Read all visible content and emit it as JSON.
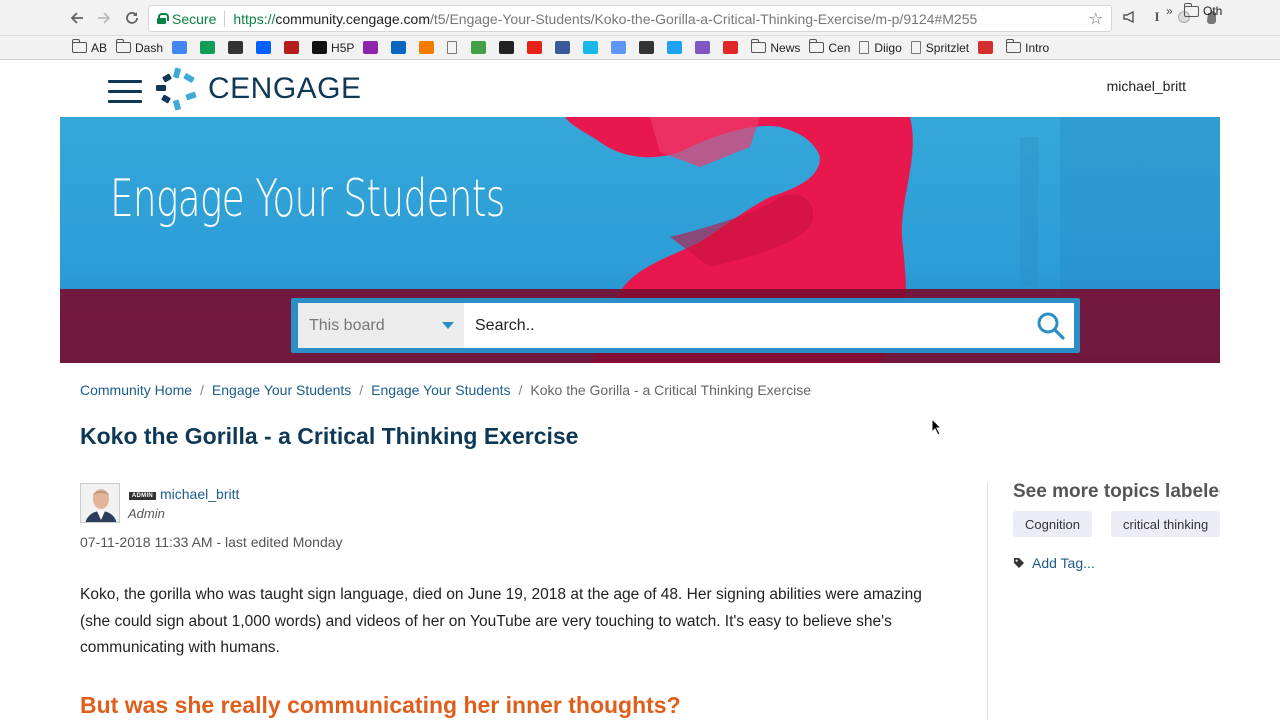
{
  "browser": {
    "secure_label": "Secure",
    "url_protocol": "https://",
    "url_host": "community.cengage.com",
    "url_path": "/t5/Engage-Your-Students/Koko-the-Gorilla-a-Critical-Thinking-Exercise/m-p/9124#M255",
    "bookmarks": [
      {
        "label": "AB",
        "icon": "folder-icon"
      },
      {
        "label": "Dash",
        "icon": "folder-icon"
      },
      {
        "label": "",
        "icon": "google-icon",
        "color": "#4285f4"
      },
      {
        "label": "",
        "icon": "drive-icon",
        "color": "#0f9d58"
      },
      {
        "label": "",
        "icon": "app-icon",
        "color": "#333333"
      },
      {
        "label": "",
        "icon": "dropbox-icon",
        "color": "#0061ff"
      },
      {
        "label": "",
        "icon": "app-icon",
        "color": "#b71c1c"
      },
      {
        "label": "H5P",
        "icon": "h5p-icon",
        "color": "#111111"
      },
      {
        "label": "",
        "icon": "app-icon",
        "color": "#8e24aa"
      },
      {
        "label": "",
        "icon": "linkedin-icon",
        "color": "#0a66c2"
      },
      {
        "label": "",
        "icon": "app-icon",
        "color": "#f57c00"
      },
      {
        "label": "",
        "icon": "doc-icon",
        "color": "#777777"
      },
      {
        "label": "",
        "icon": "app-icon",
        "color": "#43a047"
      },
      {
        "label": "",
        "icon": "buffer-icon",
        "color": "#222222"
      },
      {
        "label": "",
        "icon": "youtube-icon",
        "color": "#e62117"
      },
      {
        "label": "",
        "icon": "facebook-icon",
        "color": "#3b5998"
      },
      {
        "label": "",
        "icon": "vimeo-icon",
        "color": "#1ab7ea"
      },
      {
        "label": "",
        "icon": "app-icon",
        "color": "#5e97f6"
      },
      {
        "label": "",
        "icon": "app-icon",
        "color": "#333333"
      },
      {
        "label": "",
        "icon": "twitter-icon",
        "color": "#1da1f2"
      },
      {
        "label": "",
        "icon": "app-icon",
        "color": "#7e57c2"
      },
      {
        "label": "",
        "icon": "flipboard-icon",
        "color": "#e12828"
      },
      {
        "label": "News",
        "icon": "folder-icon"
      },
      {
        "label": "Cen",
        "icon": "folder-icon"
      },
      {
        "label": "Diigo",
        "icon": "doc-icon"
      },
      {
        "label": "Spritzlet",
        "icon": "doc-icon"
      },
      {
        "label": "",
        "icon": "app-icon",
        "color": "#d32f2f"
      },
      {
        "label": "Intro",
        "icon": "folder-icon"
      }
    ],
    "more_label": "»",
    "other_label": "Oth"
  },
  "header": {
    "logo_text": "CENGAGE",
    "username": "michael_britt"
  },
  "hero": {
    "title": "Engage Your Students",
    "colors": {
      "blue": "#2d9dd6",
      "red": "#e8184f",
      "band": "#780e32"
    }
  },
  "search": {
    "scope": "This board",
    "placeholder": "Search.."
  },
  "breadcrumbs": {
    "items": [
      "Community Home",
      "Engage Your Students",
      "Engage Your Students"
    ],
    "current": "Koko the Gorilla - a Critical Thinking Exercise",
    "separator": "/"
  },
  "post": {
    "title": "Koko the Gorilla - a Critical Thinking Exercise",
    "author": "michael_britt",
    "badge": "ADMIN",
    "role": "Admin",
    "date": "07-11-2018 11:33 AM - last edited Monday",
    "body": "Koko, the gorilla who was taught sign language, died on June 19, 2018 at the age of 48. Her signing abilities were amazing (she could sign about 1,000 words) and videos of her on YouTube are very touching to watch. It's easy to believe she's communicating with humans.",
    "subheading": "But was she really communicating her inner thoughts?"
  },
  "sidebar": {
    "title": "See more topics labeled",
    "tags": [
      "Cognition",
      "critical thinking"
    ],
    "add_tag": "Add Tag..."
  }
}
